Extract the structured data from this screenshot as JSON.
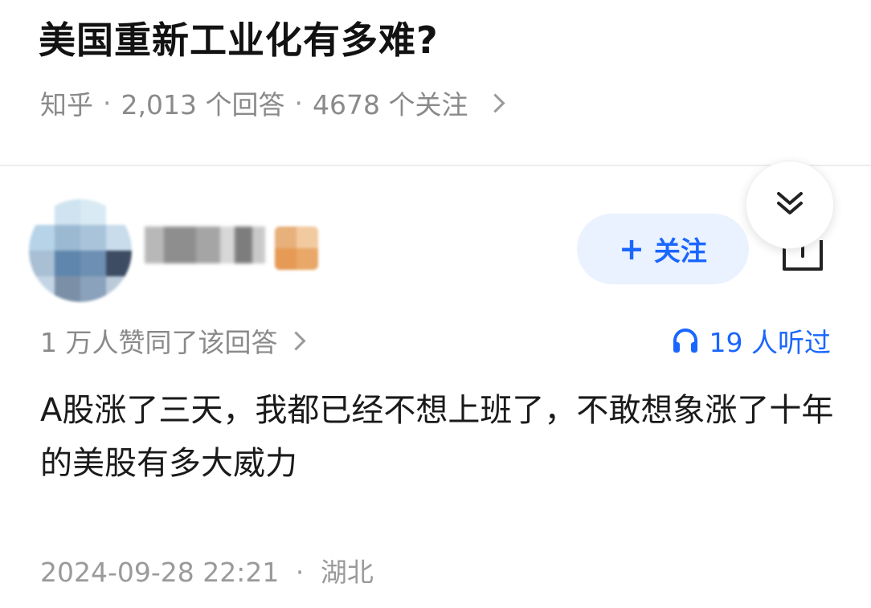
{
  "question": {
    "title": "美国重新工业化有多难?",
    "source": "知乎",
    "separator": "·",
    "answers": "2,013 个回答",
    "followers": "4678 个关注"
  },
  "answer": {
    "follow_label": "关注",
    "agree_text": "1 万人赞同了该回答",
    "listen_text": "19 人听过",
    "content": "A股涨了三天，我都已经不想上班了，不敢想象涨了十年的美股有多大威力",
    "timestamp": "2024-09-28 22:21",
    "location": "湖北"
  },
  "colors": {
    "accent": "#1a66ff",
    "follow_bg": "#eaf2ff",
    "meta_text": "#8a8a8a"
  },
  "icons": [
    "chevron-right-icon",
    "double-chevron-down-icon",
    "plus-icon",
    "share-icon",
    "headphones-icon"
  ]
}
